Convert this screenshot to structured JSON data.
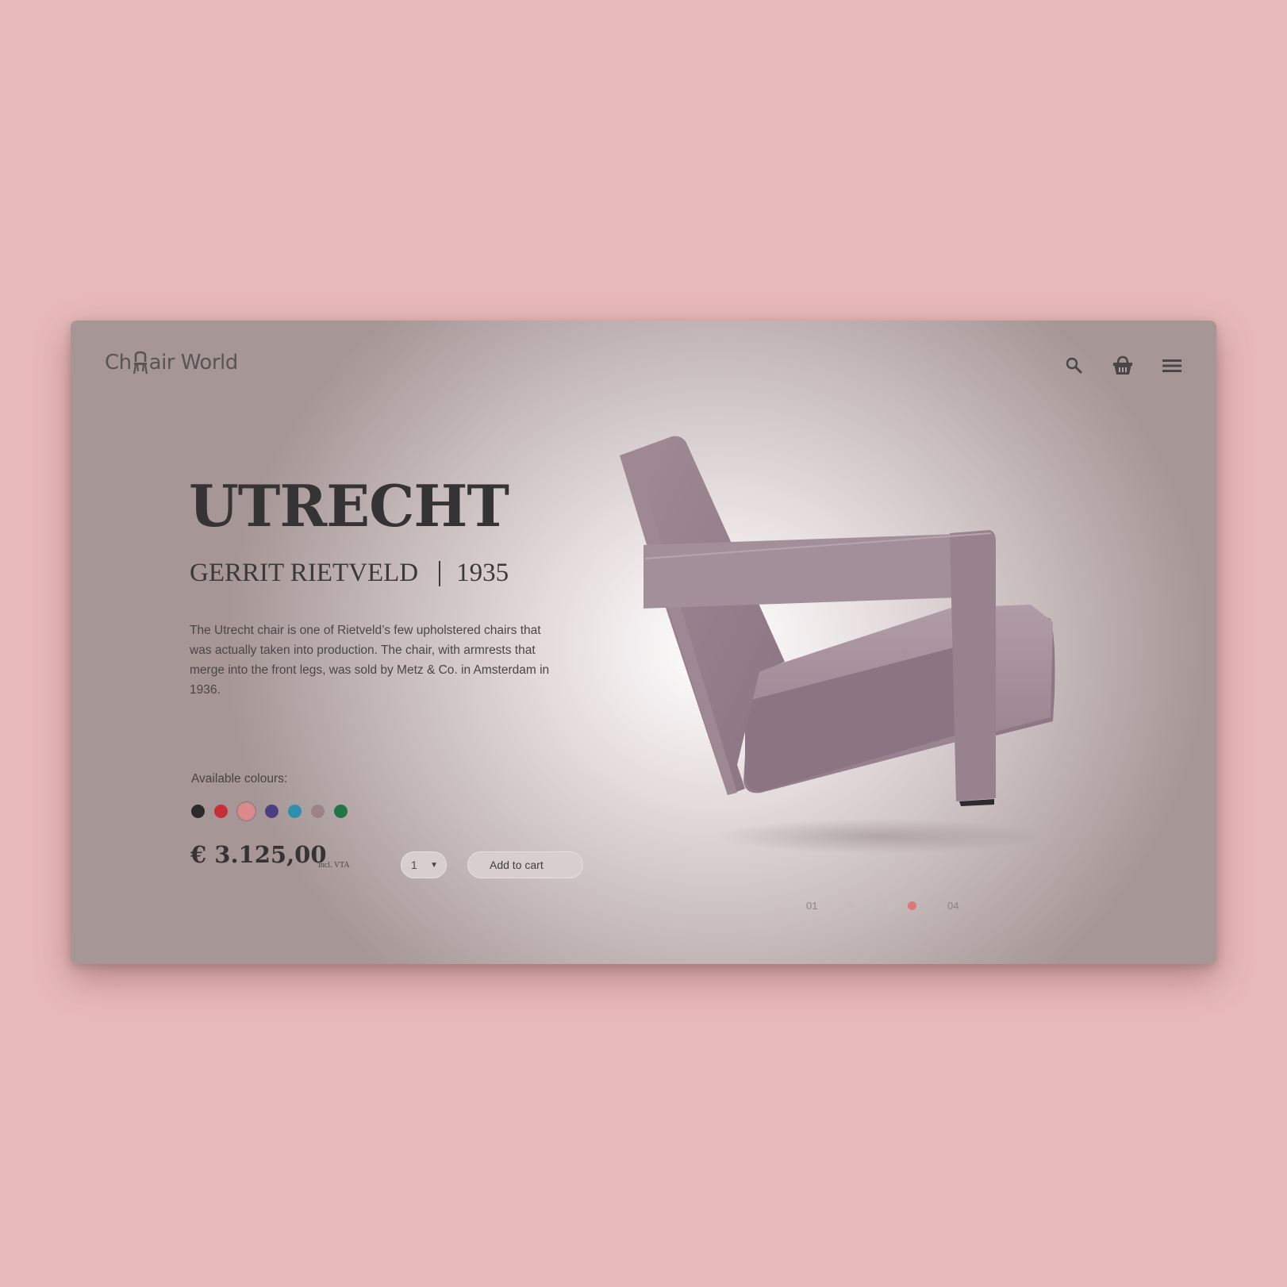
{
  "header": {
    "logo_before": "Ch",
    "logo_after": "air World",
    "icons": [
      "search-icon",
      "basket-icon",
      "menu-icon"
    ]
  },
  "product": {
    "title": "UTRECHT",
    "designer": "GERRIT RIETVELD",
    "year": "1935",
    "description": "The Utrecht chair is one of Rietveld’s few upholstered chairs that was actually taken into production. The chair, with armrests that merge into the front legs, was sold by Metz & Co. in Amsterdam in 1936.",
    "colours_label": "Available colours:",
    "colours": [
      "#2d2a2b",
      "#c62f3a",
      "#de8a8c",
      "#4b3e83",
      "#2e8fae",
      "#9a8489",
      "#227547"
    ],
    "selected_colour_index": 2,
    "price": "€ 3.125,00",
    "price_note": "incl. VTA",
    "quantity": "1",
    "add_to_cart_label": "Add to cart"
  },
  "pager": {
    "start_label": "01",
    "end_label": "04",
    "active_index": 3,
    "count": 4
  },
  "colors": {
    "page_background": "#e8b9ba",
    "accent": "#d9797b",
    "chair_fabric": "#9c8590"
  }
}
